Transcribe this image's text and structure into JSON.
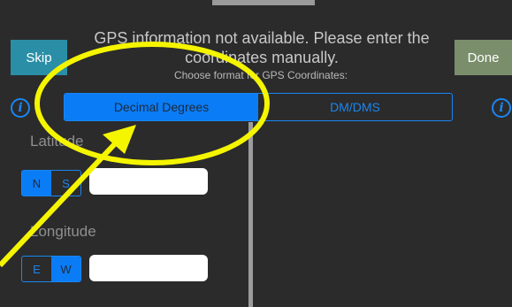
{
  "header": {
    "skip_label": "Skip",
    "done_label": "Done",
    "message": "GPS information not available. Please enter the coordinates manually.",
    "format_prompt": "Choose format for GPS Coordinates:"
  },
  "format": {
    "options": [
      "Decimal Degrees",
      "DM/DMS"
    ],
    "selected": "Decimal Degrees"
  },
  "latitude": {
    "label": "Latitude",
    "directions": [
      "N",
      "S"
    ],
    "selected": "N",
    "value": ""
  },
  "longitude": {
    "label": "Longitude",
    "directions": [
      "E",
      "W"
    ],
    "selected": "W",
    "value": ""
  },
  "icons": {
    "info_left": "info-icon",
    "info_right": "info-icon"
  },
  "colors": {
    "accent": "#0a7cf5",
    "skip": "#2a8fa6",
    "done": "#7a8e6b",
    "background": "#2b2b2c",
    "annotation": "#f5f500"
  }
}
